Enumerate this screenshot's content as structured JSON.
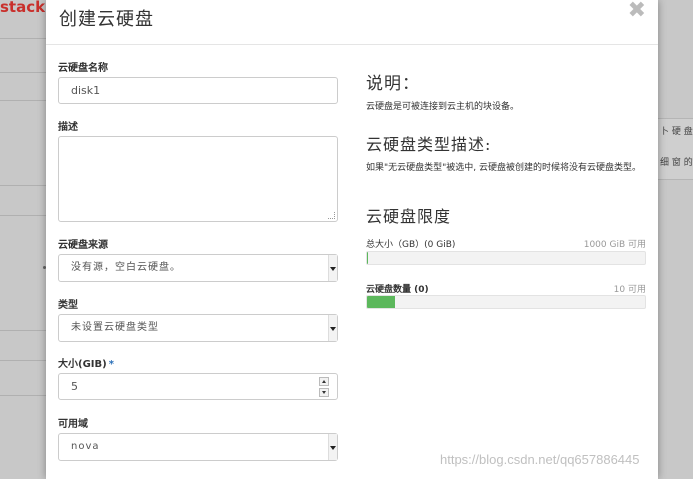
{
  "background": {
    "brand": "stack",
    "right_texts": [
      "卜 硬 盘",
      "细 窗 的"
    ]
  },
  "modal": {
    "title": "创建云硬盘",
    "close_glyph": "✖"
  },
  "form": {
    "name": {
      "label": "云硬盘名称",
      "value": "disk1"
    },
    "description": {
      "label": "描述",
      "value": ""
    },
    "source": {
      "label": "云硬盘来源",
      "selected": "没有源，空白云硬盘。"
    },
    "type": {
      "label": "类型",
      "selected": "未设置云硬盘类型"
    },
    "size": {
      "label": "大小(GIB)",
      "required_mark": "*",
      "value": "5"
    },
    "availability_zone": {
      "label": "可用域",
      "selected": "nova"
    }
  },
  "info": {
    "intro_heading": "说明：",
    "intro_text": "云硬盘是可被连接到云主机的块设备。",
    "type_heading": "云硬盘类型描述:",
    "type_text": "如果\"无云硬盘类型\"被选中, 云硬盘被创建的时候将没有云硬盘类型。",
    "limits_heading": "云硬盘限度",
    "quota_size": {
      "label": "总大小（GB）(0 GiB)",
      "max": "1000 GiB 可用",
      "fraction": 0.003
    },
    "quota_count": {
      "label": "云硬盘数量 (0)",
      "max": "10 可用",
      "fraction": 0.1
    }
  },
  "watermark": "https://blog.csdn.net/qq657886445",
  "colors": {
    "progress": "#5cb85c",
    "required": "#2a6fb8"
  }
}
